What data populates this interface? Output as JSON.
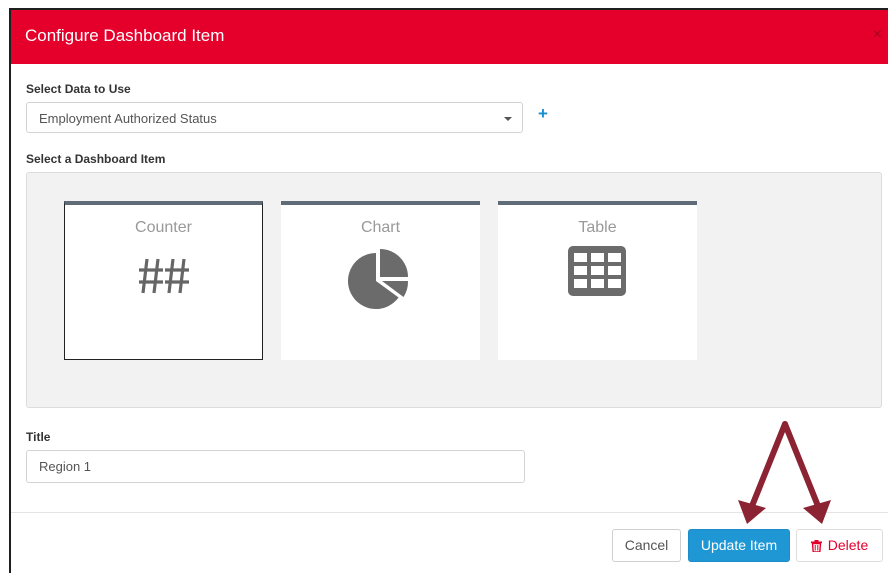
{
  "dialog": {
    "title": "Configure Dashboard Item",
    "close_label": "×"
  },
  "data_select": {
    "label": "Select Data to Use",
    "value": "Employment Authorized Status",
    "add_label": "+"
  },
  "dashboard_item": {
    "label": "Select a Dashboard Item",
    "options": [
      {
        "label": "Counter",
        "icon": "hash-icon",
        "selected": true
      },
      {
        "label": "Chart",
        "icon": "pie-chart-icon",
        "selected": false
      },
      {
        "label": "Table",
        "icon": "table-icon",
        "selected": false
      }
    ]
  },
  "title_field": {
    "label": "Title",
    "value": "Region 1"
  },
  "footer": {
    "cancel_label": "Cancel",
    "update_label": "Update Item",
    "delete_label": "Delete"
  },
  "colors": {
    "header": "#e4002b",
    "primary_button": "#1f97d4",
    "card_accent": "#5f6b76",
    "annotation_arrow": "#8b2332"
  }
}
